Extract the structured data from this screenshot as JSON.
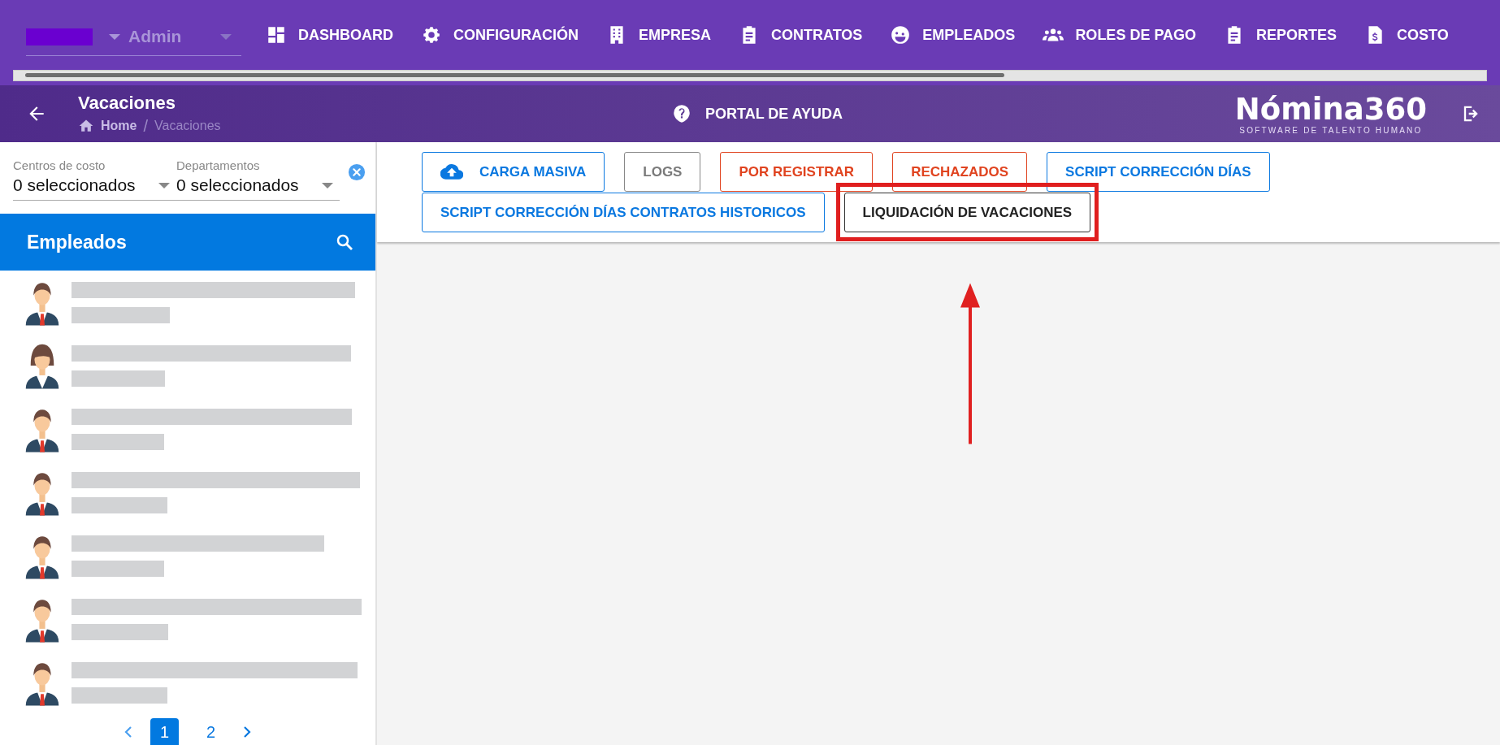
{
  "top_bar": {
    "role_select": {
      "value": "Admin"
    },
    "nav": [
      {
        "label": "DASHBOARD"
      },
      {
        "label": "CONFIGURACIÓN"
      },
      {
        "label": "EMPRESA"
      },
      {
        "label": "CONTRATOS"
      },
      {
        "label": "EMPLEADOS"
      },
      {
        "label": "ROLES DE PAGO"
      },
      {
        "label": "REPORTES"
      },
      {
        "label": "COSTO"
      }
    ]
  },
  "header": {
    "title": "Vacaciones",
    "breadcrumb": [
      "Home",
      "/",
      "Vacaciones"
    ],
    "help": "PORTAL DE AYUDA",
    "logo": {
      "name": "Nómina360",
      "tagline": "SOFTWARE DE TALENTO HUMANO"
    }
  },
  "filters": [
    {
      "label": "Centros de costo",
      "value": "0 seleccionados"
    },
    {
      "label": "Departamentos",
      "value": "0 seleccionados"
    }
  ],
  "employees": {
    "title": "Empleados",
    "rows": [
      {
        "kind": "male"
      },
      {
        "kind": "female"
      },
      {
        "kind": "male"
      },
      {
        "kind": "male"
      },
      {
        "kind": "male"
      },
      {
        "kind": "male"
      },
      {
        "kind": "male"
      }
    ]
  },
  "pagination": [
    {
      "label": "1",
      "selected": true
    },
    {
      "label": "2",
      "selected": false
    }
  ],
  "actions": [
    {
      "label": "CARGA MASIVA",
      "kind": "primary",
      "highlighted": false
    },
    {
      "label": "LOGS",
      "kind": "muted",
      "highlighted": false
    },
    {
      "label": "POR REGISTRAR",
      "kind": "danger",
      "highlighted": false
    },
    {
      "label": "RECHAZADOS",
      "kind": "danger",
      "highlighted": false
    },
    {
      "label": "SCRIPT CORRECCIÓN DÍAS",
      "kind": "primary",
      "highlighted": false
    },
    {
      "label": "SCRIPT CORRECCIÓN DÍAS CONTRATOS HISTORICOS",
      "kind": "primary",
      "highlighted": false
    },
    {
      "label": "LIQUIDACIÓN DE VACACIONES",
      "kind": "dark",
      "highlighted": true
    }
  ]
}
